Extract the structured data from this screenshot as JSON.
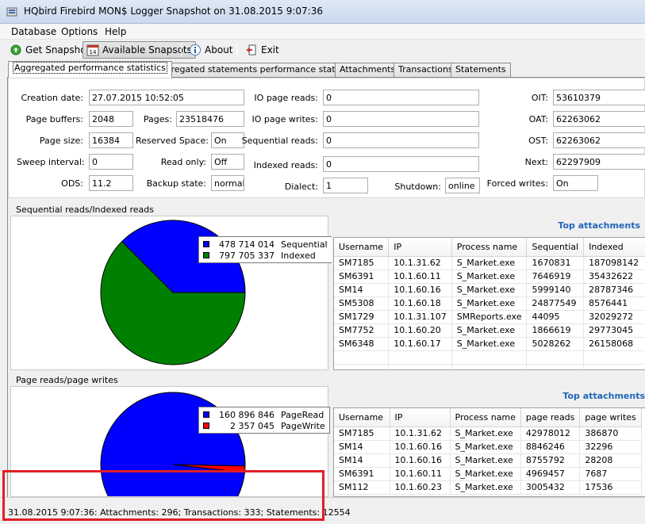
{
  "window": {
    "title": "HQbird Firebird MON$ Logger Snapshot  on 31.08.2015 9:07:36",
    "app_icon": "database-icon"
  },
  "menu": [
    {
      "label": "Database"
    },
    {
      "label": "Options"
    },
    {
      "label": "Help"
    }
  ],
  "toolbar": {
    "get_snapshot": "Get Snapshot",
    "available_snapshots": "Available Snapsots",
    "about": "About",
    "exit": "Exit"
  },
  "tabs": [
    {
      "label": "Aggregated performance statistics",
      "active": true
    },
    {
      "label": "Aggregated statements performance statistics"
    },
    {
      "label": "Attachments"
    },
    {
      "label": "Transactions"
    },
    {
      "label": "Statements"
    }
  ],
  "stats": {
    "creation_date": {
      "label": "Creation date:",
      "value": "27.07.2015 10:52:05"
    },
    "page_buffers": {
      "label": "Page buffers:",
      "value": "2048"
    },
    "pages": {
      "label": "Pages:",
      "value": "23518476"
    },
    "page_size": {
      "label": "Page size:",
      "value": "16384"
    },
    "reserved_space": {
      "label": "Reserved Space:",
      "value": "On"
    },
    "sweep_interval": {
      "label": "Sweep interval:",
      "value": "0"
    },
    "read_only": {
      "label": "Read only:",
      "value": "Off"
    },
    "ods": {
      "label": "ODS:",
      "value": "11.2"
    },
    "backup_state": {
      "label": "Backup state:",
      "value": "normal"
    },
    "io_page_reads": {
      "label": "IO page reads:",
      "value": "0"
    },
    "io_page_writes": {
      "label": "IO page writes:",
      "value": "0"
    },
    "sequential_reads": {
      "label": "Sequential reads:",
      "value": "0"
    },
    "indexed_reads": {
      "label": "Indexed reads:",
      "value": "0"
    },
    "dialect": {
      "label": "Dialect:",
      "value": "1"
    },
    "shutdown": {
      "label": "Shutdown:",
      "value": "online"
    },
    "oit": {
      "label": "OIT:",
      "value": "53610379"
    },
    "oat": {
      "label": "OAT:",
      "value": "62263062"
    },
    "ost": {
      "label": "OST:",
      "value": "62263062"
    },
    "next": {
      "label": "Next:",
      "value": "62297909"
    },
    "forced_writes": {
      "label": "Forced writes:",
      "value": "On"
    }
  },
  "section1": {
    "title": "Sequential reads/Indexed reads",
    "top_title": "Top attachments",
    "columns": [
      "Username",
      "IP",
      "Process name",
      "Sequential",
      "Indexed"
    ],
    "rows": [
      [
        "SM7185",
        "10.1.31.62",
        "S_Market.exe",
        "1670831",
        "187098142"
      ],
      [
        "SM6391",
        "10.1.60.11",
        "S_Market.exe",
        "7646919",
        "35432622"
      ],
      [
        "SM14",
        "10.1.60.16",
        "S_Market.exe",
        "5999140",
        "28787346"
      ],
      [
        "SM5308",
        "10.1.60.18",
        "S_Market.exe",
        "24877549",
        "8576441"
      ],
      [
        "SM1729",
        "10.1.31.107",
        "SMReports.exe",
        "44095",
        "32029272"
      ],
      [
        "SM7752",
        "10.1.60.20",
        "S_Market.exe",
        "1866619",
        "29773045"
      ],
      [
        "SM6348",
        "10.1.60.17",
        "S_Market.exe",
        "5028262",
        "26158068"
      ]
    ]
  },
  "section2": {
    "title": "Page reads/page writes",
    "top_title": "Top attachments",
    "columns": [
      "Username",
      "IP",
      "Process name",
      "page reads",
      "page writes"
    ],
    "rows": [
      [
        "SM7185",
        "10.1.31.62",
        "S_Market.exe",
        "42978012",
        "386870"
      ],
      [
        "SM14",
        "10.1.60.16",
        "S_Market.exe",
        "8846246",
        "32296"
      ],
      [
        "SM14",
        "10.1.60.16",
        "S_Market.exe",
        "8755792",
        "28208"
      ],
      [
        "SM6391",
        "10.1.60.11",
        "S_Market.exe",
        "4969457",
        "7687"
      ],
      [
        "SM112",
        "10.1.60.23",
        "S_Market.exe",
        "3005432",
        "17536"
      ]
    ]
  },
  "chart_data": [
    {
      "type": "pie",
      "labels": [
        "Sequential",
        "Indexed"
      ],
      "values": [
        478714014,
        797705337
      ],
      "display_values": [
        "478 714 014",
        "797 705 337"
      ],
      "colors": [
        "#0000ff",
        "#008000"
      ],
      "legend": "top-right"
    },
    {
      "type": "pie",
      "labels": [
        "PageRead",
        "PageWrite"
      ],
      "values": [
        160896846,
        2357045
      ],
      "display_values": [
        "160 896 846",
        "2 357 045"
      ],
      "colors": [
        "#0000ff",
        "#ff0000"
      ],
      "legend": "top-right"
    }
  ],
  "status": {
    "text": "31.08.2015 9:07:36: Attachments: 296; Transactions: 333; Statements: 12554",
    "highlight_color": "#e01f26"
  }
}
